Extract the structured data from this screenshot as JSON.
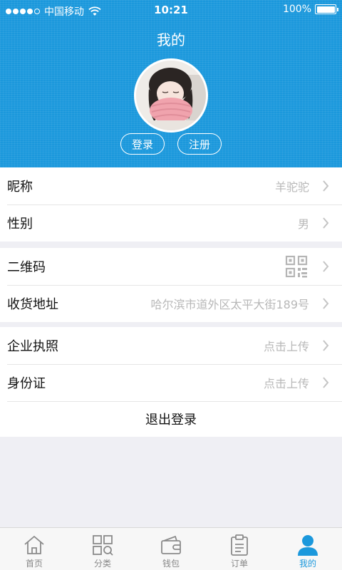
{
  "status_bar": {
    "carrier": "中国移动",
    "time": "10:21",
    "battery": "100%"
  },
  "header": {
    "title": "我的",
    "login_label": "登录",
    "register_label": "注册"
  },
  "profile_group": {
    "nickname_label": "昵称",
    "nickname_value": "羊驼驼",
    "gender_label": "性别",
    "gender_value": "男"
  },
  "info_group": {
    "qrcode_label": "二维码",
    "address_label": "收货地址",
    "address_value": "哈尔滨市道外区太平大街189号"
  },
  "doc_group": {
    "license_label": "企业执照",
    "license_value": "点击上传",
    "idcard_label": "身份证",
    "idcard_value": "点击上传"
  },
  "logout_label": "退出登录",
  "tabs": [
    {
      "label": "首页",
      "icon": "home-icon"
    },
    {
      "label": "分类",
      "icon": "category-icon"
    },
    {
      "label": "钱包",
      "icon": "wallet-icon"
    },
    {
      "label": "订单",
      "icon": "order-icon"
    },
    {
      "label": "我的",
      "icon": "user-icon",
      "active": true
    }
  ],
  "colors": {
    "accent": "#1b98dc",
    "muted_text": "#b8b8b8",
    "background": "#efeff4"
  }
}
